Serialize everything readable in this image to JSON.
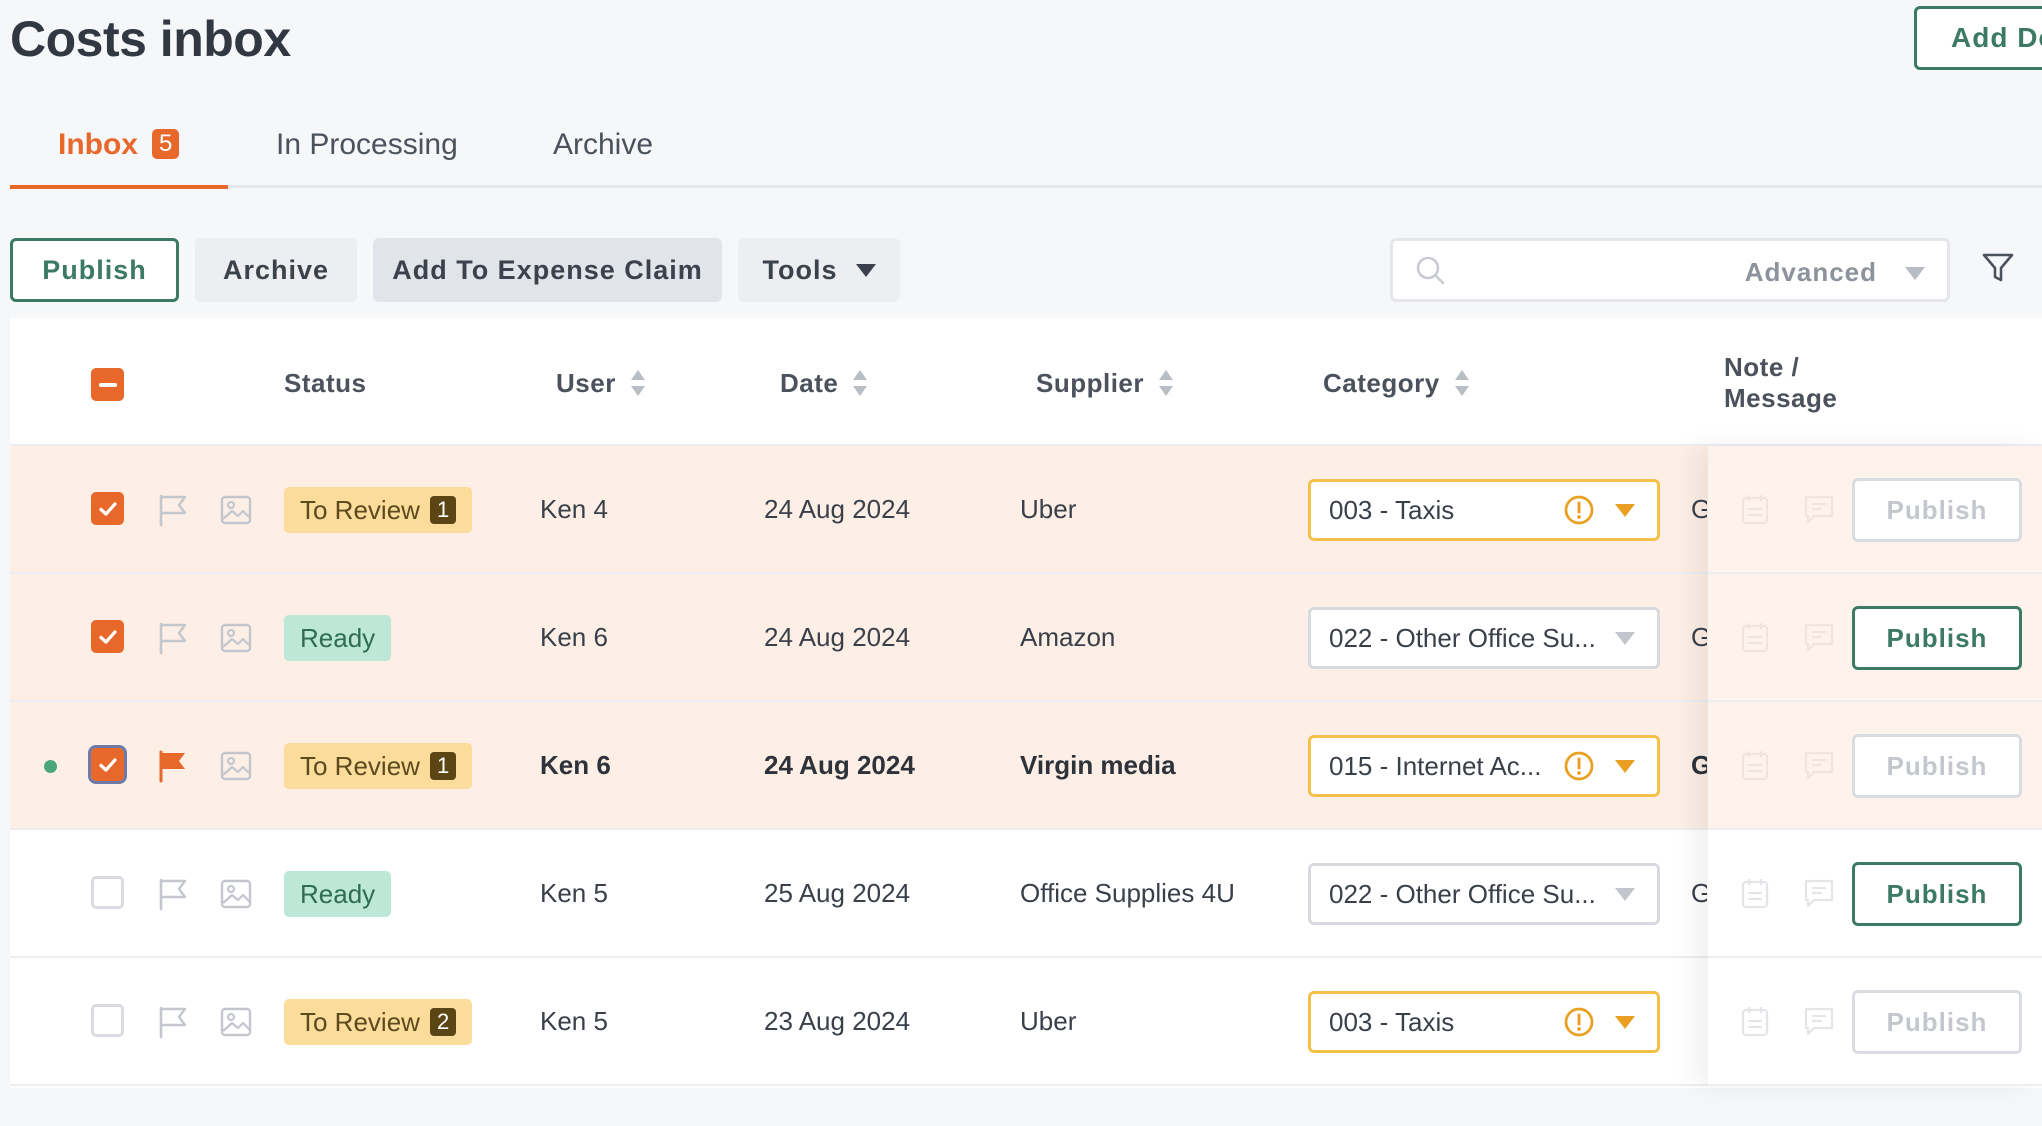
{
  "page": {
    "title": "Costs inbox",
    "add_button": "Add Do"
  },
  "tabs": [
    {
      "label": "Inbox",
      "badge": "5",
      "active": true
    },
    {
      "label": "In Processing"
    },
    {
      "label": "Archive"
    }
  ],
  "toolbar": {
    "publish": "Publish",
    "archive": "Archive",
    "add_expense": "Add To Expense Claim",
    "tools": "Tools",
    "search_placeholder": "",
    "advanced": "Advanced"
  },
  "table": {
    "headers": {
      "status": "Status",
      "user": "User",
      "date": "Date",
      "supplier": "Supplier",
      "category": "Category",
      "note": "Note /",
      "note2": "Message"
    },
    "rows": [
      {
        "checked": true,
        "flagged": false,
        "unread": false,
        "status": "To Review",
        "status_count": "1",
        "user": "Ken 4",
        "date": "24 Aug 2024",
        "supplier": "Uber",
        "category": "003 - Taxis",
        "category_warning": true,
        "note": "G",
        "publish": "Publish",
        "publish_enabled": false
      },
      {
        "checked": true,
        "flagged": false,
        "unread": false,
        "status": "Ready",
        "status_count": "",
        "user": "Ken 6",
        "date": "24 Aug 2024",
        "supplier": "Amazon",
        "category": "022 - Other Office Su...",
        "category_warning": false,
        "note": "G",
        "publish": "Publish",
        "publish_enabled": true
      },
      {
        "checked": true,
        "flagged": true,
        "unread": true,
        "status": "To Review",
        "status_count": "1",
        "user": "Ken 6",
        "date": "24 Aug 2024",
        "supplier": "Virgin media",
        "category": "015 - Internet Ac...",
        "category_warning": true,
        "note": "G",
        "publish": "Publish",
        "publish_enabled": false
      },
      {
        "checked": false,
        "flagged": false,
        "unread": false,
        "status": "Ready",
        "status_count": "",
        "user": "Ken 5",
        "date": "25 Aug 2024",
        "supplier": "Office Supplies 4U",
        "category": "022 - Other Office Su...",
        "category_warning": false,
        "note": "G",
        "publish": "Publish",
        "publish_enabled": true
      },
      {
        "checked": false,
        "flagged": false,
        "unread": false,
        "status": "To Review",
        "status_count": "2",
        "user": "Ken 5",
        "date": "23 Aug 2024",
        "supplier": "Uber",
        "category": "003 - Taxis",
        "category_warning": true,
        "note": "",
        "publish": "Publish",
        "publish_enabled": false
      }
    ]
  },
  "colors": {
    "accent": "#e8682c",
    "brand_green": "#3d7a63",
    "selected_row": "#fdefe5",
    "review": "#fbdc9a",
    "ready": "#bde7d6"
  },
  "icons": [
    "search-icon",
    "filter-icon",
    "flag-icon",
    "image-icon",
    "warning-icon",
    "note-icon",
    "message-icon",
    "check-icon",
    "sort-icon",
    "chevron-down-icon"
  ]
}
